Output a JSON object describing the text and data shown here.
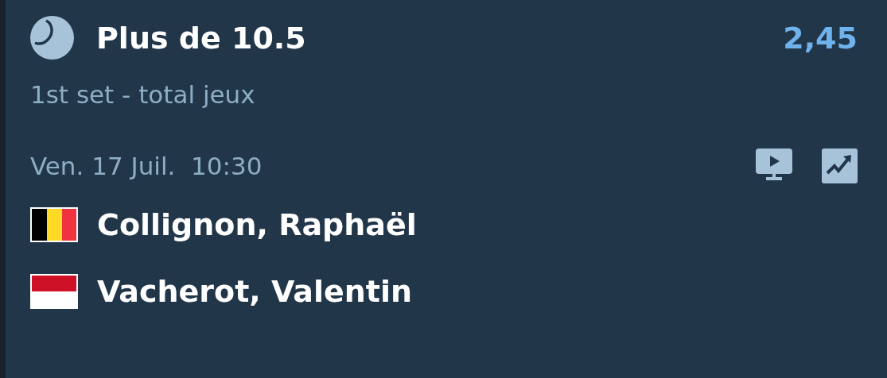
{
  "bet": {
    "selection": "Plus de 10.5",
    "odds": "2,45",
    "market": "1st set - total jeux"
  },
  "event": {
    "date": "Ven. 17 Juil.",
    "time": "10:30"
  },
  "players": [
    {
      "name": "Collignon, Raphaël",
      "kind": "be"
    },
    {
      "name": "Vacherot, Valentin",
      "kind": "mc"
    }
  ]
}
